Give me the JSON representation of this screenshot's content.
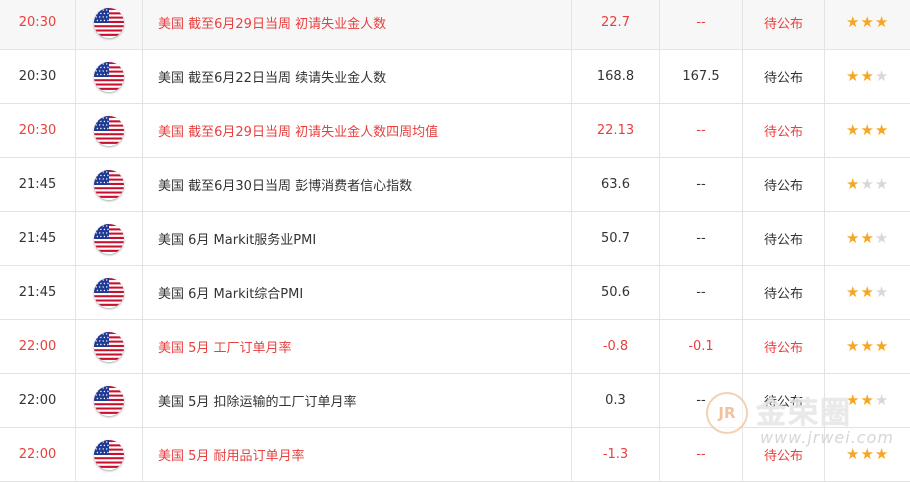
{
  "colors": {
    "highlight_text": "#e8403f",
    "normal_text": "#333333",
    "star_on": "#f5a623",
    "star_off": "#d8d8d8"
  },
  "rows": [
    {
      "time": "20:30",
      "country_flag": "us-flag-icon",
      "event": "美国 截至6月29日当周 初请失业金人数",
      "actual": "22.7",
      "previous": "--",
      "status": "待公布",
      "stars": 3,
      "highlight": true
    },
    {
      "time": "20:30",
      "country_flag": "us-flag-icon",
      "event": "美国 截至6月22日当周 续请失业金人数",
      "actual": "168.8",
      "previous": "167.5",
      "status": "待公布",
      "stars": 2,
      "highlight": false
    },
    {
      "time": "20:30",
      "country_flag": "us-flag-icon",
      "event": "美国 截至6月29日当周 初请失业金人数四周均值",
      "actual": "22.13",
      "previous": "--",
      "status": "待公布",
      "stars": 3,
      "highlight": true
    },
    {
      "time": "21:45",
      "country_flag": "us-flag-icon",
      "event": "美国 截至6月30日当周 彭博消费者信心指数",
      "actual": "63.6",
      "previous": "--",
      "status": "待公布",
      "stars": 1,
      "highlight": false
    },
    {
      "time": "21:45",
      "country_flag": "us-flag-icon",
      "event": "美国 6月 Markit服务业PMI",
      "actual": "50.7",
      "previous": "--",
      "status": "待公布",
      "stars": 2,
      "highlight": false
    },
    {
      "time": "21:45",
      "country_flag": "us-flag-icon",
      "event": "美国 6月 Markit综合PMI",
      "actual": "50.6",
      "previous": "--",
      "status": "待公布",
      "stars": 2,
      "highlight": false
    },
    {
      "time": "22:00",
      "country_flag": "us-flag-icon",
      "event": "美国 5月 工厂订单月率",
      "actual": "-0.8",
      "previous": "-0.1",
      "status": "待公布",
      "stars": 3,
      "highlight": true
    },
    {
      "time": "22:00",
      "country_flag": "us-flag-icon",
      "event": "美国 5月 扣除运输的工厂订单月率",
      "actual": "0.3",
      "previous": "--",
      "status": "待公布",
      "stars": 2,
      "highlight": false
    },
    {
      "time": "22:00",
      "country_flag": "us-flag-icon",
      "event": "美国 5月 耐用品订单月率",
      "actual": "-1.3",
      "previous": "--",
      "status": "待公布",
      "stars": 3,
      "highlight": true
    }
  ],
  "watermark": {
    "logo_glyph": "JR",
    "name": "金荣圈",
    "url": "www.jrwei.com"
  }
}
